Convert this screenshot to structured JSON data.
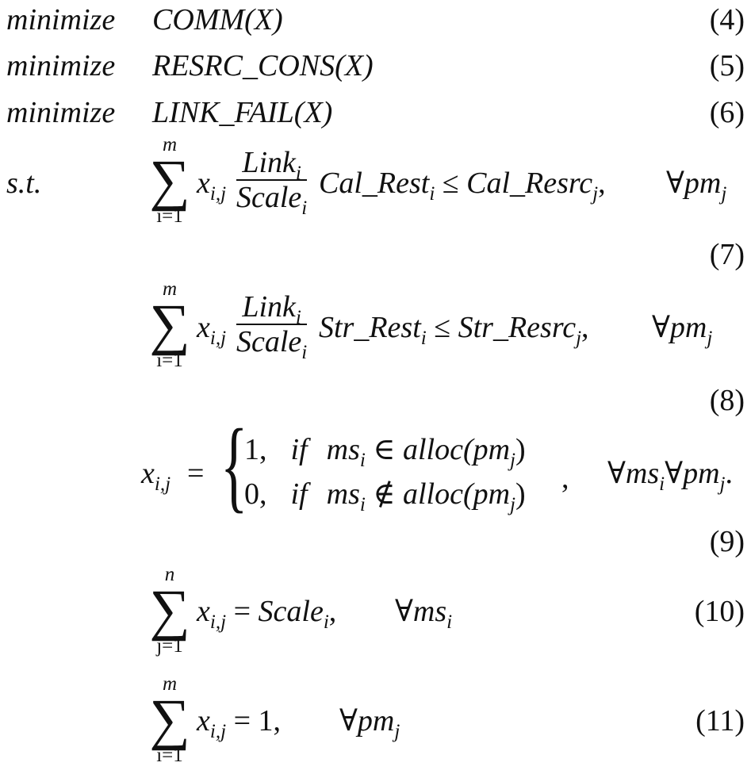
{
  "objectives": [
    {
      "keyword": "minimize",
      "expr": "COMM",
      "arg": "(X)",
      "number": "(4)"
    },
    {
      "keyword": "minimize",
      "expr": "RESRC_CONS",
      "arg": "(X)",
      "number": "(5)"
    },
    {
      "keyword": "minimize",
      "expr": "LINK_FAIL",
      "arg": "(X)",
      "number": "(6)"
    }
  ],
  "st_label": "s.t.",
  "eq7": {
    "sum_upper": "m",
    "sum_lower": "i=1",
    "sigma": "∑",
    "x": "x",
    "x_sub": "i,j",
    "num": "Link",
    "num_sub": "i",
    "den": "Scale",
    "den_sub": "i",
    "term": "Cal_Rest",
    "term_sub": "i",
    "rel": "≤",
    "rhs": "Cal_Resrc",
    "rhs_sub": "j",
    "rhs_tail": ",",
    "forall": "∀pm",
    "forall_sub": "j",
    "number": "(7)"
  },
  "eq8": {
    "sum_upper": "m",
    "sum_lower": "i=1",
    "sigma": "∑",
    "x": "x",
    "x_sub": "i,j",
    "num": "Link",
    "num_sub": "i",
    "den": "Scale",
    "den_sub": "i",
    "term": "Str_Rest",
    "term_sub": "i",
    "rel": "≤",
    "rhs": "Str_Resrc",
    "rhs_sub": "j",
    "rhs_tail": ",",
    "forall": "∀pm",
    "forall_sub": "j",
    "number": "(8)"
  },
  "eq9": {
    "lhs": "x",
    "lhs_sub": "i,j",
    "eq": "=",
    "brace": "{",
    "case1_val": "1,",
    "case1_if": "if",
    "case1_ms": "ms",
    "case1_ms_sub": "i",
    "case1_rel": "∈",
    "case1_alloc": "alloc(pm",
    "case1_alloc_sub": "j",
    "case1_close": ")",
    "case2_val": "0,",
    "case2_if": "if",
    "case2_ms": "ms",
    "case2_ms_sub": "i",
    "case2_rel": "∉",
    "case2_alloc": "alloc(pm",
    "case2_alloc_sub": "j",
    "case2_close": ")",
    "comma": ",",
    "forall_a": "∀ms",
    "forall_a_sub": "i",
    "forall_b": "∀pm",
    "forall_b_sub": "j",
    "tail": ".",
    "number": "(9)"
  },
  "eq10": {
    "sum_upper": "n",
    "sum_lower": "j=1",
    "sigma": "∑",
    "x": "x",
    "x_sub": "i,j",
    "eq": "=",
    "rhs": "Scale",
    "rhs_sub": "i",
    "rhs_tail": ",",
    "forall": "∀ms",
    "forall_sub": "i",
    "number": "(10)"
  },
  "eq11": {
    "sum_upper": "m",
    "sum_lower": "i=1",
    "sigma": "∑",
    "x": "x",
    "x_sub": "i,j",
    "eq": "=",
    "rhs": "1,",
    "forall": "∀pm",
    "forall_sub": "j",
    "number": "(11)"
  }
}
